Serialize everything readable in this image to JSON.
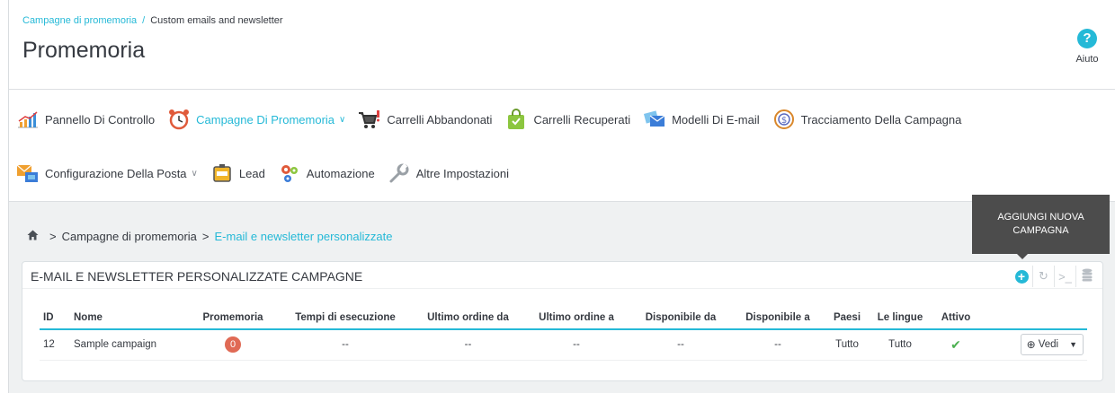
{
  "header": {
    "breadcrumb_parent": "Campagne di promemoria",
    "breadcrumb_separator": "/",
    "breadcrumb_current": "Custom emails and newsletter",
    "title": "Promemoria",
    "help_label": "Aiuto"
  },
  "nav": {
    "row1": [
      {
        "label": "Pannello Di Controllo",
        "icon": "bar-chart-icon"
      },
      {
        "label": "Campagne Di Promemoria",
        "icon": "alarm-clock-icon",
        "active": true,
        "dropdown": true
      },
      {
        "label": "Carrelli Abbandonati",
        "icon": "cart-icon"
      },
      {
        "label": "Carrelli Recuperati",
        "icon": "shopping-bag-icon"
      },
      {
        "label": "Modelli Di E-mail",
        "icon": "email-templates-icon"
      },
      {
        "label": "Tracciamento Della Campagna",
        "icon": "tracking-icon"
      }
    ],
    "row2": [
      {
        "label": "Configurazione Della Posta",
        "icon": "mail-config-icon",
        "dropdown": true
      },
      {
        "label": "Lead",
        "icon": "inbox-icon"
      },
      {
        "label": "Automazione",
        "icon": "gears-icon"
      },
      {
        "label": "Altre Impostazioni",
        "icon": "wrench-icon"
      }
    ]
  },
  "content_breadcrumb": {
    "separator": ">",
    "parent": "Campagne di promemoria",
    "current": "E-mail e newsletter personalizzate"
  },
  "tooltip": "AGGIUNGI NUOVA CAMPAGNA",
  "panel": {
    "title": "E-MAIL E NEWSLETTER PERSONALIZZATE CAMPAGNE",
    "columns": [
      "ID",
      "Nome",
      "Promemoria",
      "Tempi di esecuzione",
      "Ultimo ordine da",
      "Ultimo ordine a",
      "Disponibile da",
      "Disponibile a",
      "Paesi",
      "Le lingue",
      "Attivo"
    ],
    "row": {
      "id": "12",
      "name": "Sample campaign",
      "reminders": "0",
      "exec_times": "--",
      "last_order_from": "--",
      "last_order_to": "--",
      "available_from": "--",
      "available_to": "--",
      "countries": "Tutto",
      "languages": "Tutto",
      "active": "✔",
      "action_label": "Vedi"
    }
  },
  "colors": {
    "accent": "#25b9d7",
    "badge": "#e06a55",
    "success": "#4cb050",
    "tooltip_bg": "#4c4c4c"
  }
}
